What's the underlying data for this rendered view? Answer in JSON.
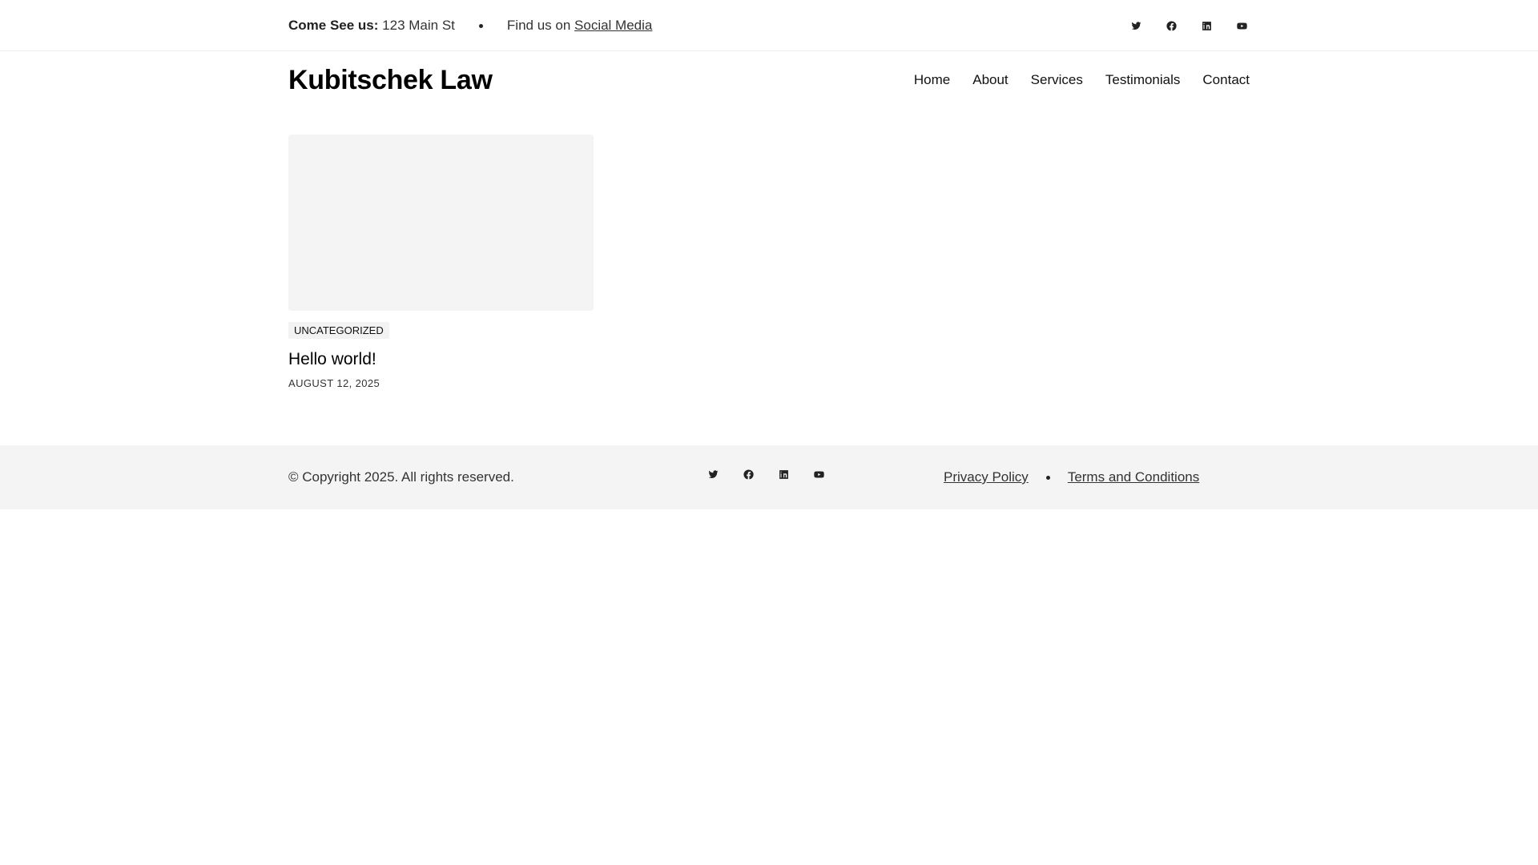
{
  "topbar": {
    "address_label": "Come See us:",
    "address_value": "123 Main St",
    "find_text": "Find us on",
    "social_link": "Social Media",
    "social_icons": [
      "twitter-icon",
      "facebook-icon",
      "linkedin-icon",
      "youtube-icon"
    ]
  },
  "header": {
    "site_title": "Kubitschek Law",
    "nav": [
      "Home",
      "About",
      "Services",
      "Testimonials",
      "Contact"
    ]
  },
  "post": {
    "category": "UNCATEGORIZED",
    "title": "Hello world!",
    "date": "AUGUST 12, 2025"
  },
  "footer": {
    "copyright": "© Copyright 2025. All rights reserved.",
    "links": [
      "Privacy Policy",
      "Terms and Conditions"
    ],
    "social_icons": [
      "twitter-icon",
      "facebook-icon",
      "linkedin-icon",
      "youtube-icon"
    ]
  },
  "colors": {
    "text": "#111111",
    "muted_bg": "#f4f4f4",
    "divider": "#eeeeee"
  }
}
